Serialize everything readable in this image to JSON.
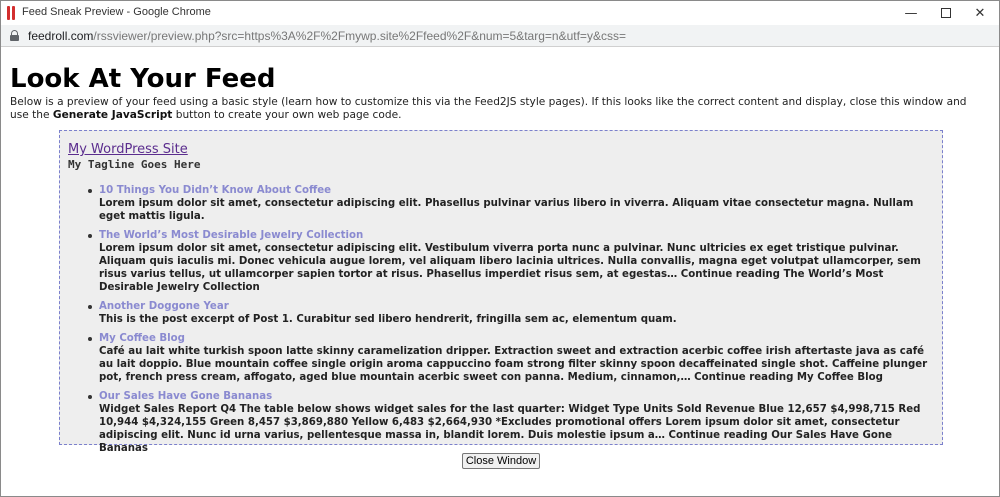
{
  "window": {
    "title": "Feed Sneak Preview - Google Chrome",
    "minimize_icon": "minimize-icon",
    "maximize_icon": "maximize-icon",
    "close_icon": "close-icon"
  },
  "address_bar": {
    "host": "feedroll.com",
    "path": "/rssviewer/preview.php?src=https%3A%2F%2Fmywp.site%2Ffeed%2F&num=5&targ=n&utf=y&css="
  },
  "page": {
    "heading": "Look At Your Feed",
    "intro_text": "Below is a preview of your feed using a basic style (learn how to customize this via the Feed2JS style pages). If this looks like the correct content and display, close this window and use the ",
    "intro_bold": "Generate JavaScript",
    "intro_tail": " button to create your own web page code."
  },
  "feed": {
    "site_title": "My WordPress Site",
    "tagline": "My Tagline Goes Here",
    "items": [
      {
        "title": "10 Things You Didn’t Know About Coffee",
        "description": "Lorem ipsum dolor sit amet, consectetur adipiscing elit. Phasellus pulvinar varius libero in viverra. Aliquam vitae consectetur magna. Nullam eget mattis ligula."
      },
      {
        "title": "The World’s Most Desirable Jewelry Collection",
        "description": "Lorem ipsum dolor sit amet, consectetur adipiscing elit. Vestibulum viverra porta nunc a pulvinar. Nunc ultricies ex eget tristique pulvinar. Aliquam quis iaculis mi. Donec vehicula augue lorem, vel aliquam libero lacinia ultrices. Nulla convallis, magna eget volutpat ullamcorper, sem risus varius tellus, ut ullamcorper sapien tortor at risus. Phasellus imperdiet risus sem, at egestas… Continue reading The World’s Most Desirable Jewelry Collection"
      },
      {
        "title": "Another Doggone Year",
        "description": "This is the post excerpt of Post 1. Curabitur sed libero hendrerit, fringilla sem ac, elementum quam."
      },
      {
        "title": "My Coffee Blog",
        "description": "Café au lait white turkish spoon latte skinny caramelization dripper. Extraction sweet and extraction acerbic coffee irish aftertaste java as café au lait doppio. Blue mountain coffee single origin aroma cappuccino foam strong filter skinny spoon decaffeinated single shot. Caffeine plunger pot, french press cream, affogato, aged blue mountain acerbic sweet con panna. Medium, cinnamon,… Continue reading My Coffee Blog"
      },
      {
        "title": "Our Sales Have Gone Bananas",
        "description": "Widget Sales Report Q4 The table below shows widget sales for the last quarter: Widget Type Units Sold Revenue Blue 12,657 $4,998,715 Red 10,944 $4,324,155 Green 8,457 $3,869,880 Yellow 6,483 $2,664,930 *Excludes promotional offers Lorem ipsum dolor sit amet, consectetur adipiscing elit. Nunc id urna varius, pellentesque massa in, blandit lorem. Duis molestie ipsum a… Continue reading Our Sales Have Gone Bananas"
      }
    ]
  },
  "close_button": {
    "label": "Close Window"
  },
  "colors": {
    "feed_border": "#7b80cc",
    "item_title": "#8a8ad0",
    "site_title": "#5b2d8e",
    "feed_background": "#eeeeee"
  }
}
